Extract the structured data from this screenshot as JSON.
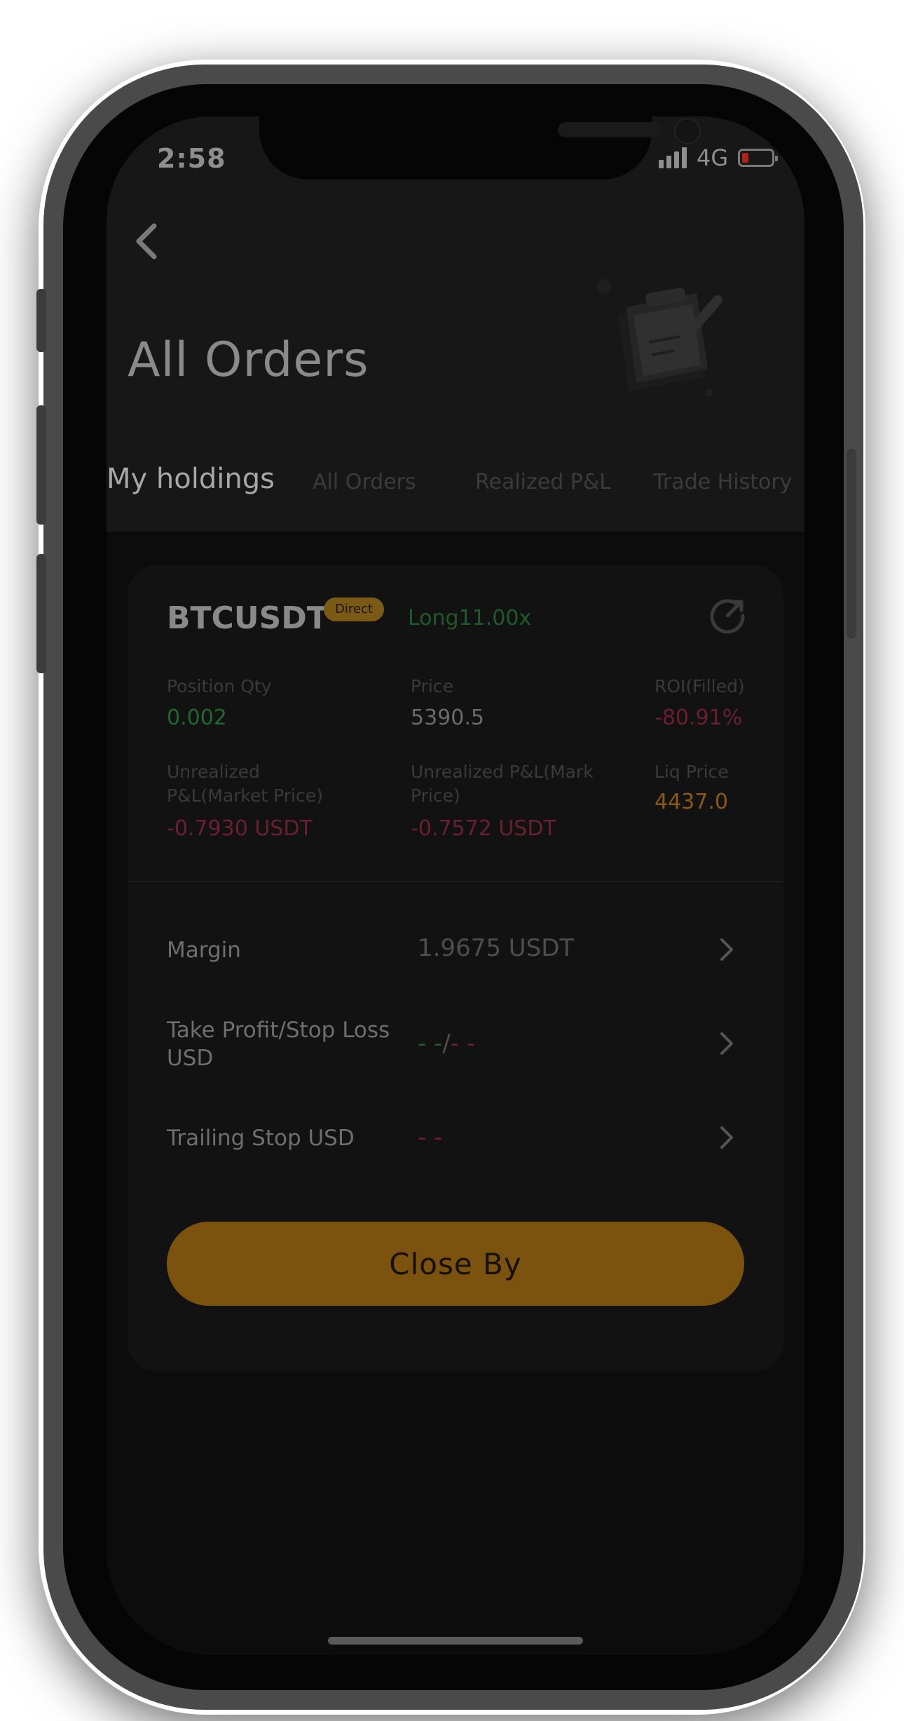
{
  "status_bar": {
    "time": "2:58",
    "network": "4G",
    "battery_color": "#b0201e"
  },
  "header": {
    "back_icon": "chevron-left-icon",
    "title": "All Orders",
    "illustration_icon": "clipboard-pen-icon"
  },
  "tabs": [
    {
      "label": "My holdings",
      "active": true
    },
    {
      "label": "All Orders",
      "active": false
    },
    {
      "label": "Realized P&L",
      "active": false
    },
    {
      "label": "Trade History",
      "active": false
    }
  ],
  "position": {
    "symbol": "BTCUSDT",
    "badge": "Direct",
    "side_leverage": "Long11.00x",
    "refresh_icon": "refresh-icon",
    "stats": {
      "position_qty_label": "Position Qty",
      "position_qty_value": "0.002",
      "price_label": "Price",
      "price_value": "5390.5",
      "roi_label": "ROI(Filled)",
      "roi_value": "-80.91%",
      "upl_market_label_line1": "Unrealized",
      "upl_market_label_line2": "P&L(Market Price)",
      "upl_market_value": "-0.7930 USDT",
      "upl_mark_label_line1": "Unrealized P&L(Mark",
      "upl_mark_label_line2": "Price)",
      "upl_mark_value": "-0.7572 USDT",
      "liq_price_label": "Liq Price",
      "liq_price_value": "4437.0"
    },
    "rows": {
      "margin_label": "Margin",
      "margin_value": "1.9675 USDT",
      "tpsl_label_line1": "Take Profit/Stop Loss",
      "tpsl_label_line2": "USD",
      "tpsl_tp_value": "- -",
      "tpsl_separator": "/",
      "tpsl_sl_value": "- -",
      "trailing_label": "Trailing Stop USD",
      "trailing_value": "- -"
    },
    "close_button": "Close By"
  },
  "colors": {
    "positive": "#1e6a2c",
    "negative": "#6a1f33",
    "liq": "#8a5a10",
    "accent": "#7b520e"
  }
}
